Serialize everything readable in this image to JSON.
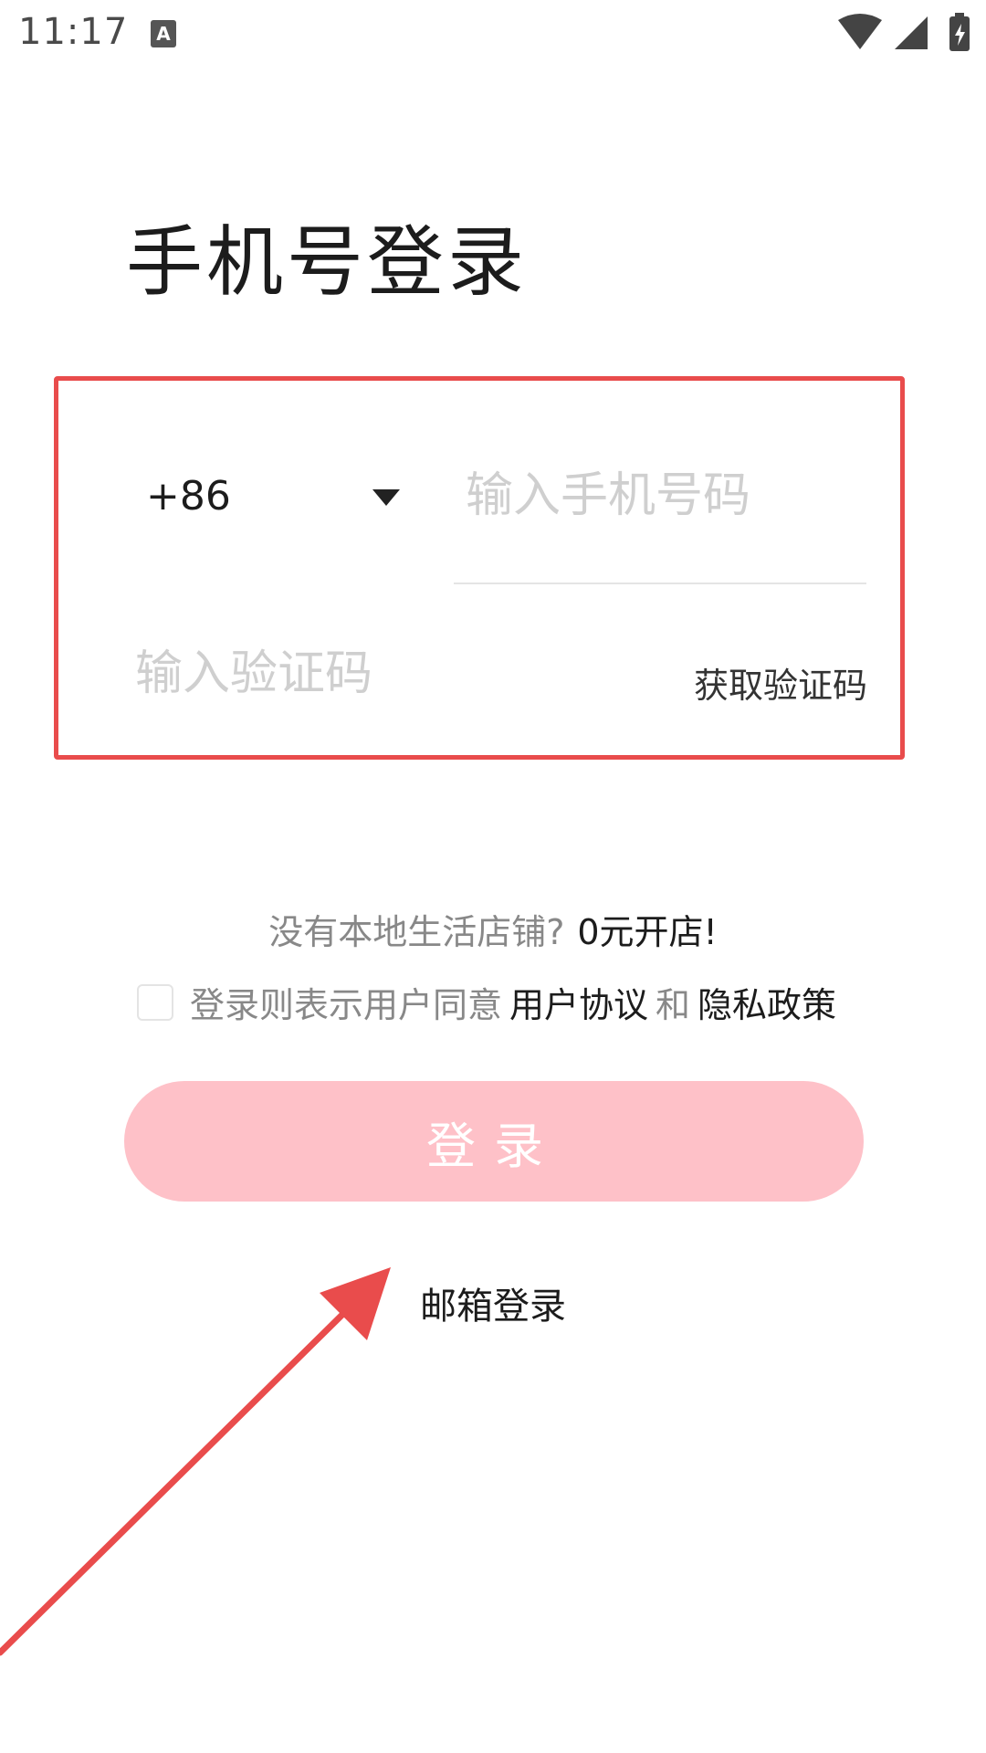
{
  "status_bar": {
    "time": "11:17",
    "notification_badge": "A",
    "icons": [
      "wifi-icon",
      "signal-icon",
      "battery-charging-icon"
    ]
  },
  "title": "手机号登录",
  "form": {
    "country_code": "+86",
    "phone_placeholder": "输入手机号码",
    "phone_value": "",
    "code_placeholder": "输入验证码",
    "code_value": "",
    "get_code_label": "获取验证码"
  },
  "store_prompt": {
    "question": "没有本地生活店铺?",
    "cta": "0元开店!"
  },
  "agreement": {
    "checked": false,
    "prefix": "登录则表示用户同意",
    "user_agreement": "用户协议",
    "and": "和",
    "privacy_policy": "隐私政策"
  },
  "login_button_label": "登录",
  "email_login_label": "邮箱登录",
  "colors": {
    "highlight_border": "#e94c4c",
    "login_button_bg": "#fec1c8",
    "arrow": "#e94c4c"
  }
}
